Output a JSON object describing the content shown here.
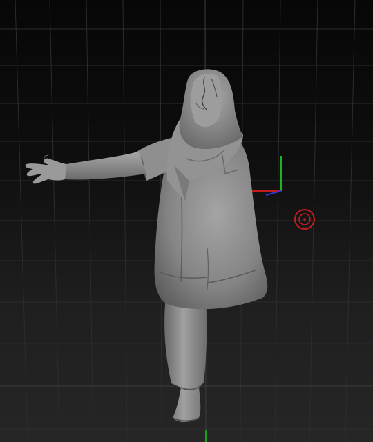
{
  "viewport": {
    "scene_label": "",
    "colors": {
      "background_top": "#070707",
      "background_bottom": "#262627",
      "grid_line": "#3a3a3c",
      "sculpt_base": "#8a8a8a",
      "sculpt_highlight": "#b2b2b2",
      "sculpt_shadow": "#4a4a4a",
      "axis_x": "#d01818",
      "axis_y": "#18b818",
      "axis_z": "#2a3ad8",
      "pivot_ring": "#d51f1f"
    },
    "model": {
      "name": "clay-figure",
      "pose": "arm-extended"
    }
  }
}
